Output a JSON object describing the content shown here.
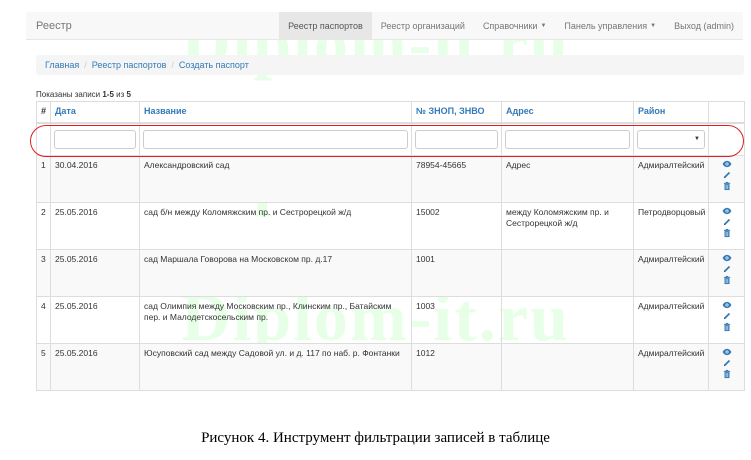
{
  "navbar": {
    "brand": "Реестр",
    "items": [
      {
        "label": "Реестр паспортов",
        "active": true,
        "dropdown": false
      },
      {
        "label": "Реестр организаций",
        "active": false,
        "dropdown": false
      },
      {
        "label": "Справочники",
        "active": false,
        "dropdown": true
      },
      {
        "label": "Панель управления",
        "active": false,
        "dropdown": true
      },
      {
        "label": "Выход (admin)",
        "active": false,
        "dropdown": false
      }
    ]
  },
  "breadcrumb": {
    "home": "Главная",
    "registry": "Реестр паспортов",
    "current": "Создать паспорт"
  },
  "summary": {
    "prefix": "Показаны записи ",
    "range": "1-5",
    "middle": " из ",
    "total": "5"
  },
  "table": {
    "headers": {
      "num": "#",
      "date": "Дата",
      "name": "Название",
      "code": "№ ЗНОП, ЗНВО",
      "address": "Адрес",
      "district": "Район"
    },
    "rows": [
      {
        "num": "1",
        "date": "30.04.2016",
        "name": "Александровский сад",
        "code": "78954-45665",
        "address": "Адрес",
        "district": "Адмиралтейский"
      },
      {
        "num": "2",
        "date": "25.05.2016",
        "name": "сад б/н между Коломяжским пр. и Сестрорецкой ж/д",
        "code": "15002",
        "address": "между Коломяжским пр. и Сестрорецкой ж/д",
        "district": "Петродворцовый"
      },
      {
        "num": "3",
        "date": "25.05.2016",
        "name": "сад Маршала Говорова на Московском пр. д.17",
        "code": "1001",
        "address": "",
        "district": "Адмиралтейский"
      },
      {
        "num": "4",
        "date": "25.05.2016",
        "name": "сад Олимпия между Московским пр., Клинским пр., Батайским пер. и Малодетскосельским пр.",
        "code": "1003",
        "address": "",
        "district": "Адмиралтейский"
      },
      {
        "num": "5",
        "date": "25.05.2016",
        "name": "Юсуповский сад между Садовой ул. и д. 117 по наб. р. Фонтанки",
        "code": "1012",
        "address": "",
        "district": "Адмиралтейский"
      }
    ]
  },
  "icons": {
    "view": "eye-icon",
    "edit": "pencil-icon",
    "delete": "trash-icon"
  },
  "watermark": "Diplom-it.ru",
  "caption": "Рисунок 4. Инструмент фильтрации записей в таблице",
  "colors": {
    "link": "#337ab7",
    "highlight": "#e01f1f",
    "watermark": "#78ff78"
  }
}
